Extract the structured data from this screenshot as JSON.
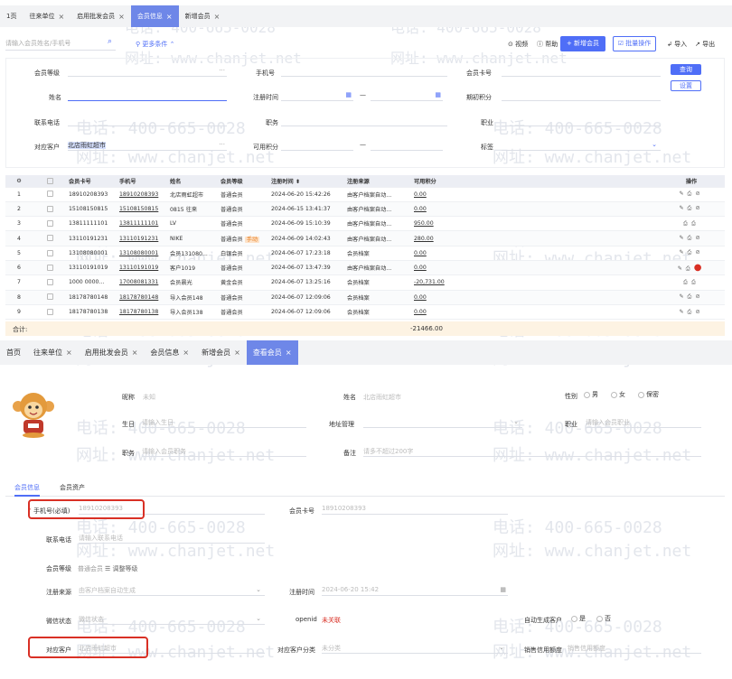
{
  "top_tabs": [
    {
      "label": "1页",
      "closable": false,
      "active": false
    },
    {
      "label": "往来单位",
      "closable": true,
      "active": false
    },
    {
      "label": "启用批发会员",
      "closable": true,
      "active": false
    },
    {
      "label": "会员信息",
      "closable": true,
      "active": true
    },
    {
      "label": "新增会员",
      "closable": true,
      "active": false
    }
  ],
  "toolbar": {
    "search_placeholder": "请输入会员姓名/手机号",
    "more_conditions": "更多条件",
    "video": "视频",
    "help": "帮助",
    "add_member": "+ 新增会员",
    "batch": "批量操作",
    "import": "导入",
    "export": "导出"
  },
  "filters": {
    "level": "会员等级",
    "phone": "手机号",
    "card_no": "会员卡号",
    "name": "姓名",
    "reg_time": "注册时间",
    "points": "期初积分",
    "contact": "联系电话",
    "position": "职务",
    "job": "职业",
    "customer": "对应客户",
    "customer_value": "北店雨虹超市",
    "available_points": "可用积分",
    "tag": "标签",
    "query": "查询",
    "settings": "设置",
    "dots": "···",
    "dash": "—"
  },
  "table": {
    "headers": [
      "",
      "",
      "会员卡号",
      "手机号",
      "姓名",
      "会员等级",
      "注册时间 ⬍",
      "注册来源",
      "可用积分",
      "操作"
    ],
    "rows": [
      {
        "no": "1",
        "card": "18910208393",
        "phone": "18910208393",
        "name": "北店雨虹超市",
        "level": "普通会员",
        "tag": "",
        "time": "2024-06-20 15:42:26",
        "source": "由客户档案自动...",
        "points": "0.00",
        "ops": [
          "✎",
          "⎙",
          "⊘"
        ]
      },
      {
        "no": "2",
        "card": "15108150815",
        "phone": "15108150815",
        "name": "0815 往来",
        "level": "普通会员",
        "tag": "",
        "time": "2024-06-15 13:41:37",
        "source": "由客户档案自动...",
        "points": "0.00",
        "ops": [
          "✎",
          "⎙",
          "⊘"
        ]
      },
      {
        "no": "3",
        "card": "13811111101",
        "phone": "13811111101",
        "name": "LV",
        "level": "普通会员",
        "tag": "",
        "time": "2024-06-09 15:10:39",
        "source": "由客户档案自动...",
        "points": "950.00",
        "ops": [
          "⎙",
          "⎙"
        ]
      },
      {
        "no": "4",
        "card": "13110191231",
        "phone": "13110191231",
        "name": "NIKE",
        "level": "普通会员",
        "tag": "手动",
        "time": "2024-06-09 14:02:43",
        "source": "由客户档案自动...",
        "points": "280.00",
        "ops": [
          "✎",
          "⎙",
          "⊘"
        ]
      },
      {
        "no": "5",
        "card": "13108080001",
        "phone": "13108080001",
        "name": "会员131080...",
        "level": "白银会员",
        "tag": "",
        "time": "2024-06-07 17:23:18",
        "source": "会员档案",
        "points": "0.00",
        "ops": [
          "✎",
          "⎙",
          "⊘"
        ]
      },
      {
        "no": "6",
        "card": "13110191019",
        "phone": "13110191019",
        "name": "客户1019",
        "level": "普通会员",
        "tag": "",
        "time": "2024-06-07 13:47:39",
        "source": "由客户档案自动...",
        "points": "0.00",
        "ops": [
          "✎",
          "⎙",
          "●"
        ]
      },
      {
        "no": "7",
        "card": "1000 0000...",
        "phone": "17008081331",
        "name": "会员晨光",
        "level": "黄金会员",
        "tag": "",
        "time": "2024-06-07 13:25:16",
        "source": "会员档案",
        "points": "-20,731.00",
        "ops": [
          "⎙",
          "⎙"
        ]
      },
      {
        "no": "8",
        "card": "18178780148",
        "phone": "18178780148",
        "name": "导入会员148",
        "level": "普通会员",
        "tag": "",
        "time": "2024-06-07 12:09:06",
        "source": "会员档案",
        "points": "0.00",
        "ops": [
          "✎",
          "⎙",
          "⊘"
        ]
      },
      {
        "no": "9",
        "card": "18178780138",
        "phone": "18178780138",
        "name": "导入会员138",
        "level": "普通会员",
        "tag": "",
        "time": "2024-06-07 12:09:06",
        "source": "会员档案",
        "points": "0.00",
        "ops": [
          "✎",
          "⎙",
          "⊘"
        ]
      }
    ],
    "total_label": "合计:",
    "total_points": "-21466.00"
  },
  "bottom_tabs": [
    {
      "label": "首页",
      "closable": false,
      "active": false
    },
    {
      "label": "往来单位",
      "closable": true,
      "active": false
    },
    {
      "label": "启用批发会员",
      "closable": true,
      "active": false
    },
    {
      "label": "会员信息",
      "closable": true,
      "active": false
    },
    {
      "label": "新增会员",
      "closable": true,
      "active": false
    },
    {
      "label": "查看会员",
      "closable": true,
      "active": true
    }
  ],
  "detail": {
    "nickname_label": "昵称",
    "nickname_value": "未知",
    "name_label": "姓名",
    "name_value": "北店雨虹超市",
    "gender_label": "性别",
    "gender_options": [
      "男",
      "女",
      "保密"
    ],
    "birthday_label": "生日",
    "birthday_placeholder": "请输入生日",
    "address_label": "地址管理",
    "job_label": "职业",
    "job_placeholder": "请输入会员职业",
    "position_label": "职务",
    "position_placeholder": "请输入会员职务",
    "remark_label": "备注",
    "remark_placeholder": "请多不超过200字"
  },
  "detail_tabs": [
    "会员信息",
    "会员资产"
  ],
  "form": {
    "phone_label": "手机号(必填)",
    "phone_value": "18910208393",
    "card_label": "会员卡号",
    "card_value": "18910208393",
    "contact_label": "联系电话",
    "contact_placeholder": "请输入联系电话",
    "level_label": "会员等级",
    "level_value": "普通会员",
    "adjust_level": "调整等级",
    "source_label": "注册来源",
    "source_value": "由客户档案自动生成",
    "regtime_label": "注册时间",
    "regtime_value": "2024-06-20 15:42",
    "wechat_label": "微信状态",
    "wechat_value": "微信状态",
    "openid_label": "openid",
    "openid_value": "未关联",
    "auto_label": "自动生成客户",
    "auto_options": [
      "是",
      "否"
    ],
    "customer_label": "对应客户",
    "customer_value": "北店雨虹超市",
    "customer_cat_label": "对应客户分类",
    "customer_cat_value": "未分类",
    "credit_label": "销售信用额度",
    "credit_placeholder": "销售信用额度"
  },
  "watermark": {
    "phone": "电话: 400-665-0028",
    "site": "网址: www.chanjet.net"
  },
  "colors": {
    "accent": "#4f6ef7",
    "active_tab": "#6e87e8",
    "highlight": "#d93025",
    "total_row": "#fdf3e3"
  }
}
